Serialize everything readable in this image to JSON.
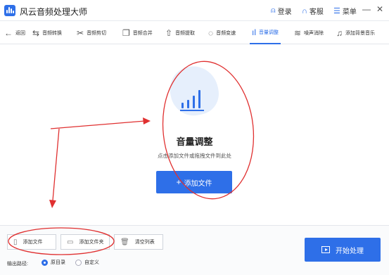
{
  "app": {
    "title": "风云音频处理大师"
  },
  "titlebar": {
    "login": "登录",
    "support": "客服",
    "menu": "菜单",
    "minimize": "—",
    "close": "✕"
  },
  "toolbar": {
    "back": "返回",
    "tools": [
      "音频转换",
      "音频剪切",
      "音频合并",
      "音频提取",
      "音频变速",
      "音量调整",
      "噪声消除",
      "添加背景音乐"
    ],
    "active_tool": "音量调整"
  },
  "main": {
    "title": "音量调整",
    "hint": "点击添加文件或拖拽文件到此处",
    "add_button": "添加文件"
  },
  "bottom": {
    "add_file": "添加文件",
    "add_folder": "添加文件夹",
    "clear_list": "清空列表",
    "start": "开始处理",
    "output_label": "输出路径:",
    "output_options": [
      "原目录",
      "自定义"
    ],
    "selected_output": "原目录"
  },
  "colors": {
    "accent": "#2e6fe8",
    "annotation": "#e03030"
  }
}
